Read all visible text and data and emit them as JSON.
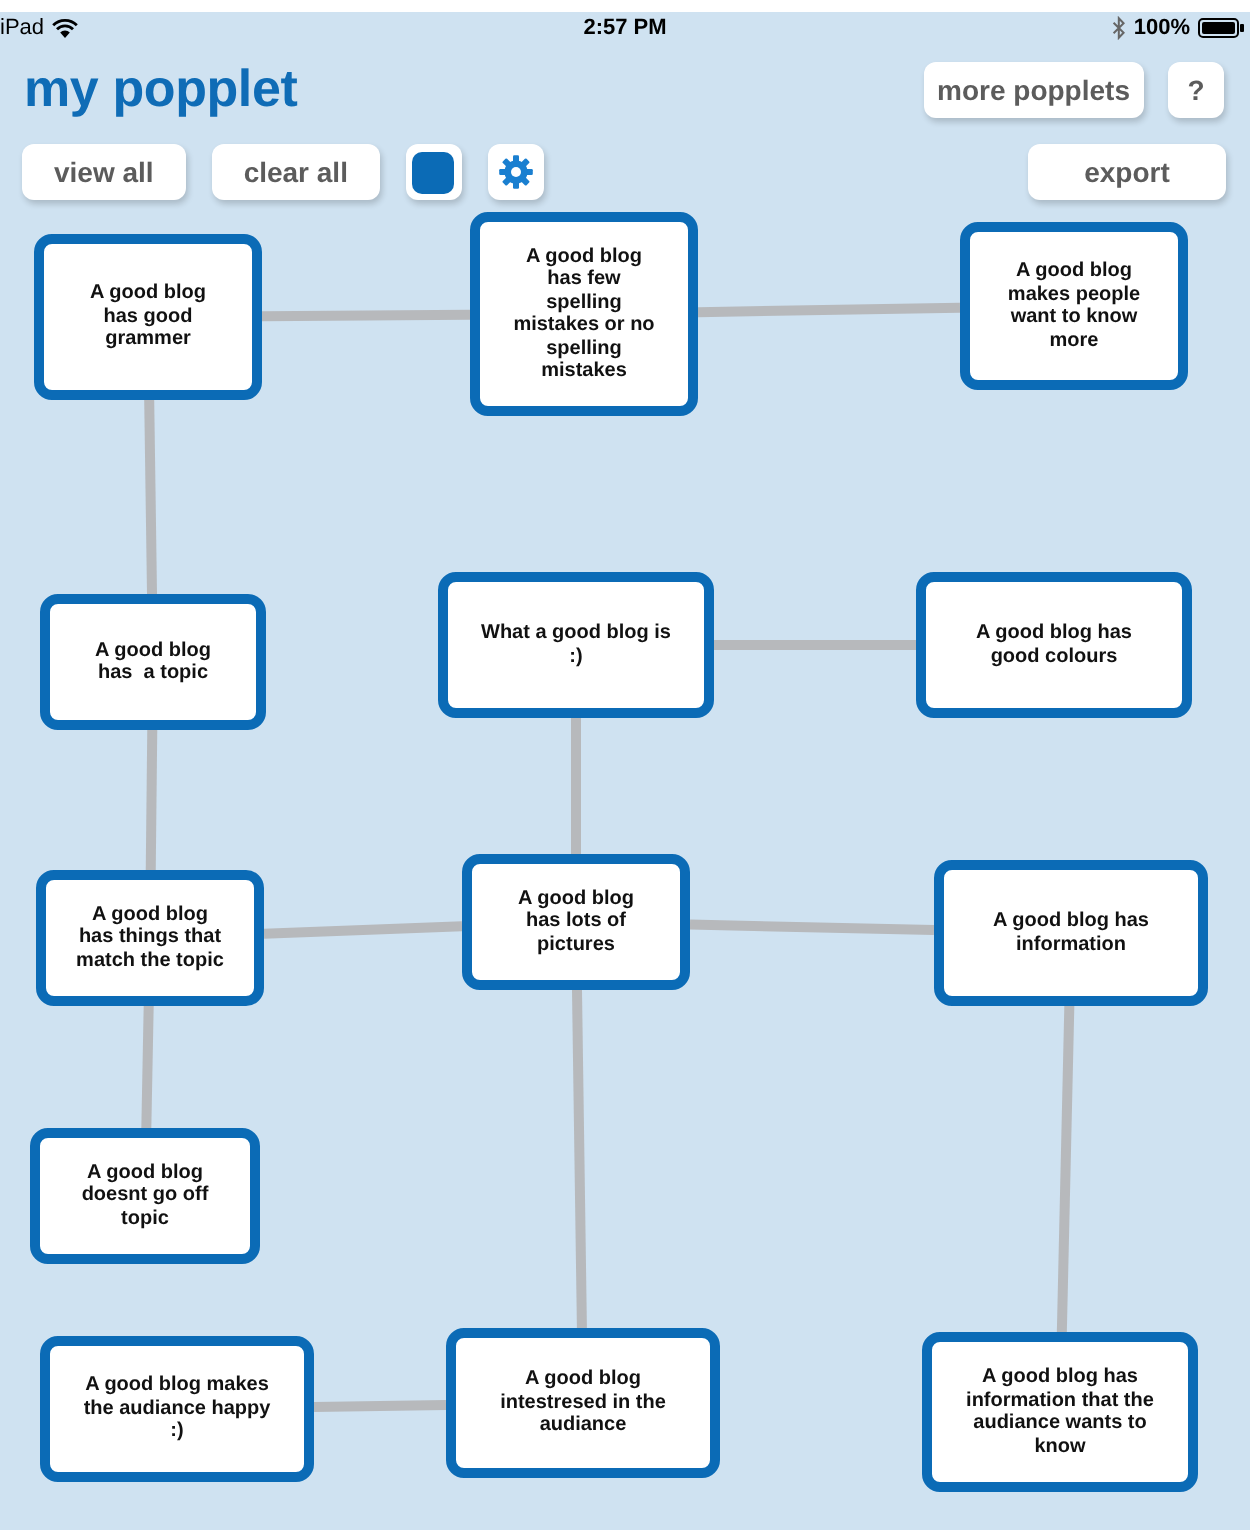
{
  "status_bar": {
    "device": "iPad",
    "time": "2:57 PM",
    "battery": "100%"
  },
  "header": {
    "title": "my popplet",
    "buttons": [
      "more popplets",
      "?"
    ]
  },
  "toolbar": {
    "left": [
      {
        "kind": "text",
        "label": "view all"
      },
      {
        "kind": "text",
        "label": "clear all"
      },
      {
        "kind": "color"
      },
      {
        "kind": "settings"
      }
    ],
    "right": [
      {
        "kind": "text",
        "label": "export"
      }
    ]
  },
  "board": {
    "root": {
      "text": "What a good blog is :)",
      "children": [
        {
          "text": "A good blog has good colours"
        },
        {
          "text": "A good blog has lots of pictures",
          "children": [
            {
              "text": "A good blog has things that match the topic",
              "children": [
                {
                  "text": "A good blog has  a topic",
                  "children": [
                    {
                      "text": "A good blog has good grammer",
                      "children": [
                        {
                          "text": "A good blog has few spelling mistakes or no spelling mistakes",
                          "children": [
                            {
                              "text": "A good blog makes people want to know more"
                            }
                          ]
                        }
                      ]
                    }
                  ]
                },
                {
                  "text": "A good blog doesnt go off topic"
                }
              ]
            },
            {
              "text": "A good blog has information",
              "children": [
                {
                  "text": "A good blog has information that the audiance wants to know"
                }
              ]
            },
            {
              "text": "A good blog intestresed in the audiance",
              "children": [
                {
                  "text": "A good blog makes the audiance happy :)"
                }
              ]
            }
          ]
        }
      ]
    }
  }
}
